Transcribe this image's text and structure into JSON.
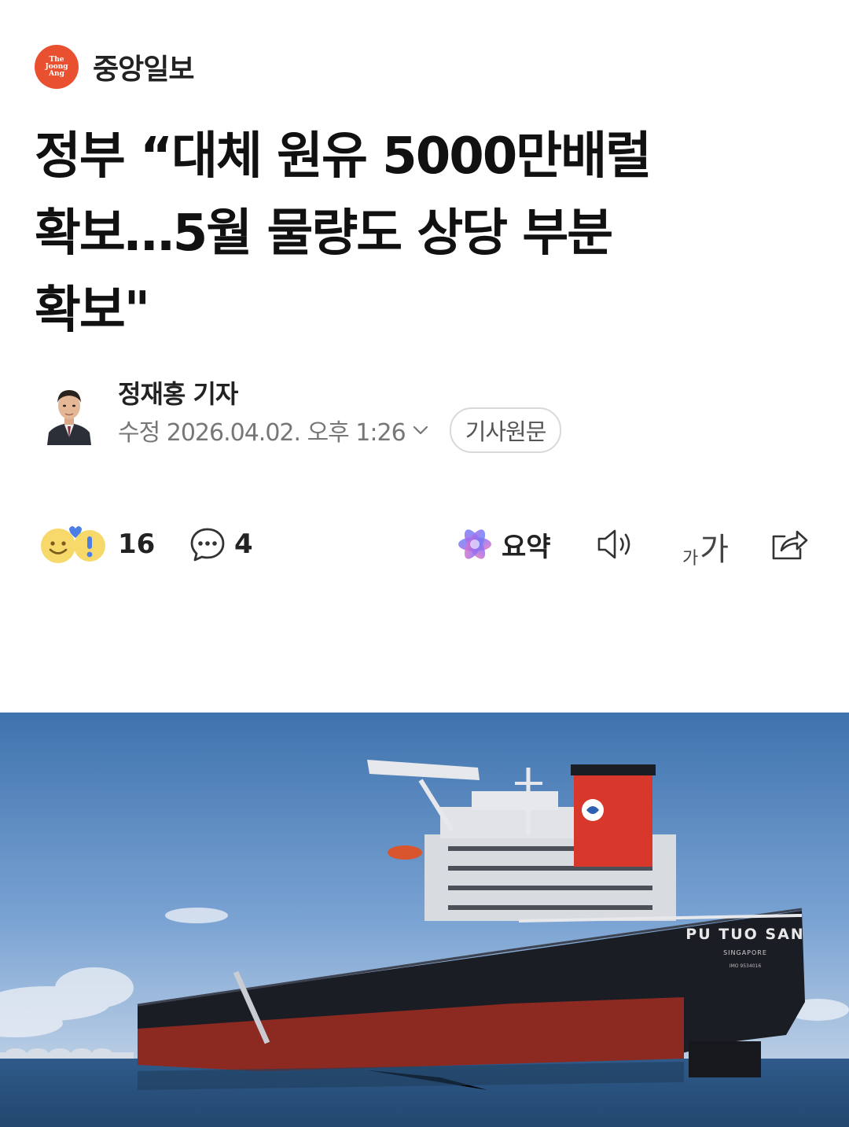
{
  "publisher": {
    "logo_lines": [
      "The",
      "Joong",
      "Ang"
    ],
    "name": "중앙일보"
  },
  "article": {
    "headline_lines": [
      "정부 “대체 원유 5000만배럴",
      "확보…5월 물량도 상당 부분",
      "확보\""
    ]
  },
  "byline": {
    "author": "정재홍 기자",
    "date": "수정 2026.04.02. 오후 1:26",
    "original_button": "기사원문"
  },
  "actions": {
    "reaction_count": "16",
    "comment_count": "4",
    "summary_label": "요약",
    "font_small": "가",
    "font_big": "가"
  },
  "photo": {
    "ship_name": "PU TUO SAN",
    "home_port": "SINGAPORE",
    "imo_text": "IMO 9534016"
  },
  "colors": {
    "brand": "#e8502f",
    "sky": "#4f7fb8",
    "hull_red": "#8c2a22",
    "hull_black": "#1b1d24",
    "funnel_red": "#d8382c"
  },
  "icons": {
    "reaction": "emoji-reaction-icon",
    "comment": "comment-bubble-icon",
    "summary": "ai-summary-icon",
    "audio": "speaker-icon",
    "font": "font-size-icon",
    "share": "share-icon",
    "chevron": "chevron-down-icon"
  }
}
